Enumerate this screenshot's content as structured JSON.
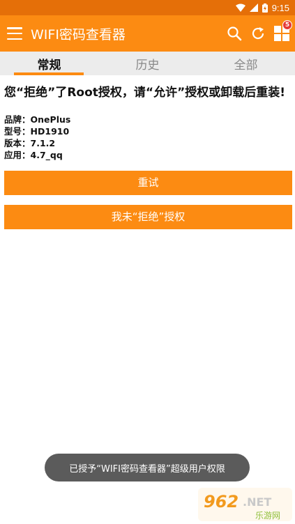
{
  "status_bar": {
    "time": "9:15"
  },
  "app_bar": {
    "title": "WIFI密码查看器",
    "badge_count": "5",
    "menu_icon": "menu-icon",
    "search_icon": "search-icon",
    "refresh_icon": "refresh-icon",
    "apps_icon": "apps-icon"
  },
  "tabs": [
    {
      "label": "常规",
      "active": true
    },
    {
      "label": "历史",
      "active": false
    },
    {
      "label": "全部",
      "active": false
    }
  ],
  "main": {
    "message": "您“拒绝”了Root授权，请“允许”授权或卸载后重装!",
    "device_info": [
      {
        "key": "品牌",
        "value": "OnePlus"
      },
      {
        "key": "型号",
        "value": "HD1910"
      },
      {
        "key": "版本",
        "value": "7.1.2"
      },
      {
        "key": "应用",
        "value": "4.7_qq"
      }
    ],
    "retry_button": "重试",
    "not_denied_button": "我未“拒绝”授权"
  },
  "toast": {
    "text": "已授予“WIFI密码查看器”超级用户权限"
  },
  "watermark": {
    "text": "962.NET",
    "subtext": "乐游网"
  },
  "colors": {
    "status_bar": "#e56f08",
    "app_bar": "#fc8b12",
    "accent": "#fc8b12",
    "toast_bg": "#5b5b5b"
  }
}
